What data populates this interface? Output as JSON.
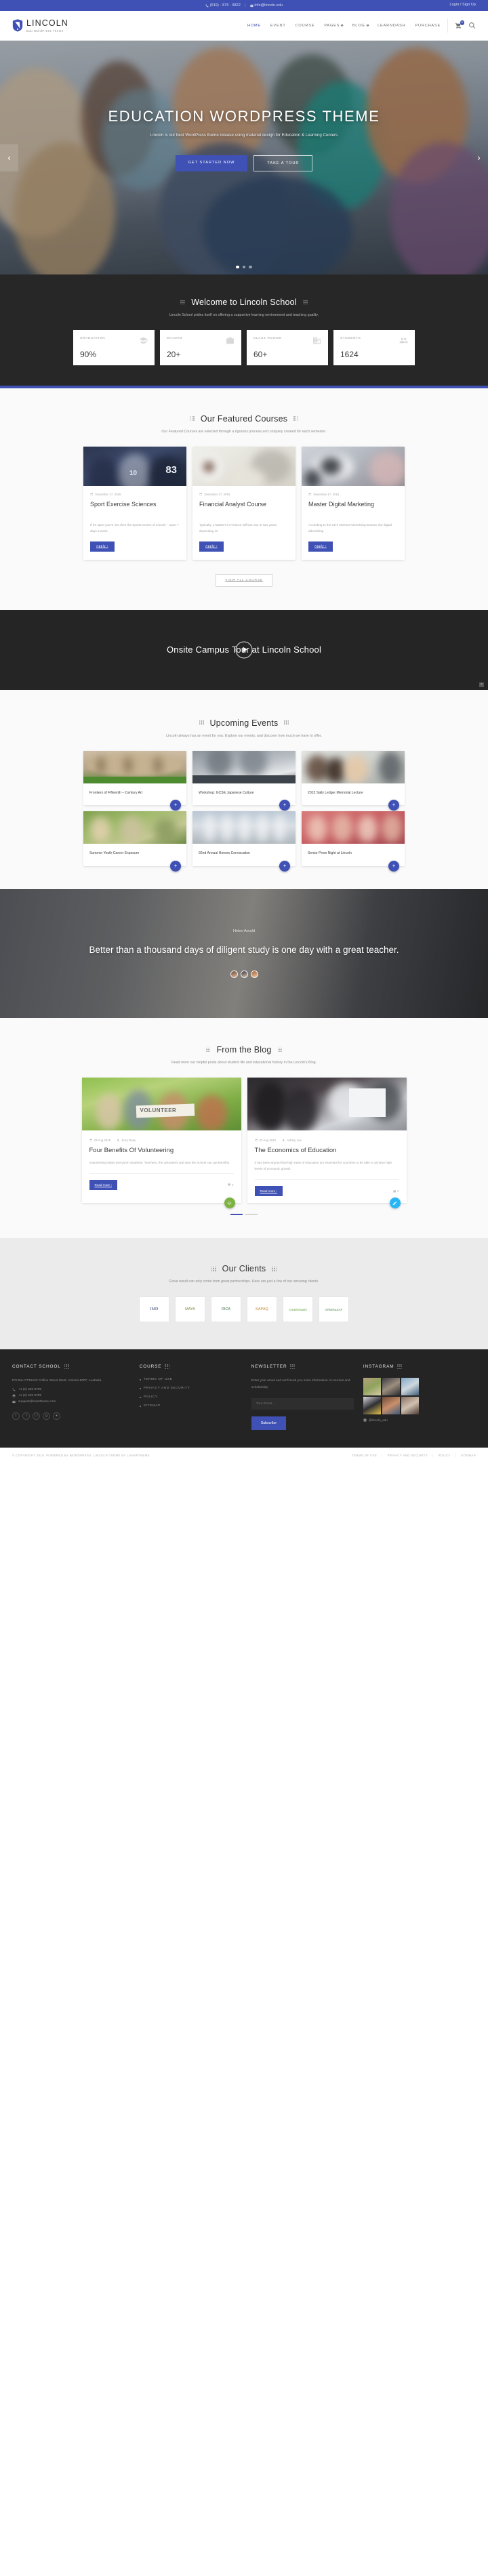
{
  "topbar": {
    "phone": "(519) - 875 - 9822",
    "email": "info@lincoln.edu",
    "separator": "|",
    "login": "Login / Sign Up"
  },
  "nav": {
    "brand_name": "LINCOLN",
    "brand_tagline": "Edu WordPress Theme",
    "items": [
      {
        "label": "HOME",
        "active": true,
        "caret": false
      },
      {
        "label": "EVENT",
        "active": false,
        "caret": false
      },
      {
        "label": "COURSE",
        "active": false,
        "caret": false
      },
      {
        "label": "PAGES",
        "active": false,
        "caret": true
      },
      {
        "label": "BLOG",
        "active": false,
        "caret": true
      },
      {
        "label": "LEARNDASH",
        "active": false,
        "caret": false
      },
      {
        "label": "PURCHASE",
        "active": false,
        "caret": false
      }
    ],
    "cart_count": "0"
  },
  "hero": {
    "title": "EDUCATION WORDPRESS THEME",
    "subtitle": "Lincoln is our best WordPress theme release using material design for Education & Learning Centers",
    "primary_button": "GET STARTED NOW",
    "secondary_button": "TAKE A TOUR",
    "prev": "‹",
    "next": "›",
    "slides": 3,
    "active_slide": 1
  },
  "welcome": {
    "title": "Welcome to Lincoln School",
    "desc": "Lincoln School prides itself on offering a supportive learning environment and teaching quality.",
    "stats": [
      {
        "label": "GRADUATION",
        "value": "90%",
        "icon": "graduation-cap-icon"
      },
      {
        "label": "MAJORS",
        "value": "20+",
        "icon": "briefcase-icon"
      },
      {
        "label": "CLASS ROOMS",
        "value": "60+",
        "icon": "building-icon"
      },
      {
        "label": "STUDENTS",
        "value": "1624",
        "icon": "users-icon"
      }
    ]
  },
  "courses": {
    "title": "Our Featured Courses",
    "desc": "Our Featured Courses are selected through a rigorous process and uniquely created for each semester.",
    "view_all": "VIEW ALL COURSE",
    "apply_label": "Apply ›",
    "items": [
      {
        "date": "December 17, 2015",
        "title": "Sport Exercise Sciences",
        "excerpt": "If it's sport you're into then the Sports Centre of Lincoln – open 7 days a week,"
      },
      {
        "date": "December 17, 2015",
        "title": "Financial Analyst Course",
        "excerpt": "Typically, a Masters in Finance will last one or two years, depending on"
      },
      {
        "date": "December 17, 2015",
        "title": "Master Digital Marketing",
        "excerpt": "According to the UK's Internet Advertising Bureau, the digital advertising"
      }
    ]
  },
  "video": {
    "heading": "Onsite Campus Tour at Lincoln School",
    "close": "×"
  },
  "events": {
    "title": "Upcoming Events",
    "desc": "Lincoln always has an event for you. Explore our events, and discover how much we have to offer.",
    "plus": "+",
    "items": [
      {
        "title": "Frontiers of Fifteenth – Century Art"
      },
      {
        "title": "Workshop: GCSE Japanese Culture"
      },
      {
        "title": "2015 Sally Ledger Memorial Lecture"
      },
      {
        "title": "Summer Youth Career Exposure"
      },
      {
        "title": "92nd Annual Honors Convocation"
      },
      {
        "title": "Senior Prom Night at Lincoln"
      }
    ]
  },
  "quote": {
    "author": "Helen Arnold",
    "text": "Better than a thousand days of diligent study is one day with a great teacher."
  },
  "blog": {
    "title": "From the Blog",
    "desc": "Read more our helpful posts about student life and educational history in the Lincoln's Blog.",
    "read_more": "Read more ›",
    "items": [
      {
        "date": "23 Aug 2015",
        "author": "Jerry Rose",
        "title": "Four Benefits Of Volunteering",
        "excerpt": "Volunteering helps everyone! Students, Teachers, the volunteers and also the School can get benefits.",
        "comments": "0",
        "badge_color": "#7cb342",
        "badge_icon": "layers-icon"
      },
      {
        "date": "22 Aug 2015",
        "author": "Ashley Lee",
        "title": "The Economics of Education",
        "excerpt": "It has been argued that high rates of education are essential for countries to be able to achieve high levels of economic growth.",
        "comments": "0",
        "badge_color": "#29b6f6",
        "badge_icon": "pencil-icon"
      }
    ]
  },
  "clients": {
    "title": "Our Clients",
    "desc": "Great result can only come from great partnerships. Here are just a few of our amazing clients.",
    "logos": [
      "IMD",
      "MAYA",
      "RICA",
      "KAPAQ",
      "CreativeSpark",
      "GREENLEAF"
    ]
  },
  "footer": {
    "contact": {
      "title": "CONTACT SCHOOL",
      "address": "PO Box CT16122 Collins Street West, Victoria 8007, Australia.",
      "phone": "+1 (2) 345 6789",
      "fax": "+1 (2) 345 6789",
      "email": "support@lunartheme.com",
      "social": [
        "twitter-icon",
        "facebook-icon",
        "instagram-icon",
        "google-plus-icon",
        "dribbble-icon"
      ]
    },
    "course": {
      "title": "COURSE",
      "links": [
        "TERMS OF USE",
        "PRIVACY AND SECURITY",
        "POLICY",
        "SITEMAP"
      ]
    },
    "newsletter": {
      "title": "NEWSLETTER",
      "desc": "Enter your email and we'll send you more information of courses and scholarship.",
      "placeholder": "Your Email...",
      "value": "",
      "button": "Subscribe"
    },
    "instagram": {
      "title": "INSTAGRAM",
      "handle": "@lincoln_edu"
    },
    "copyright": "© COPYRIGHT 2016. POWERED BY WORDPRESS. LINCOLN THEME BY LUNARTHEME.",
    "bottom_links": [
      "TERMS OF USE",
      "PRIVACY AND SECURITY",
      "POLICY",
      "SITEMAP"
    ]
  },
  "colors": {
    "accent": "#3f51b5",
    "dark": "#272727",
    "light": "#fafafa"
  }
}
